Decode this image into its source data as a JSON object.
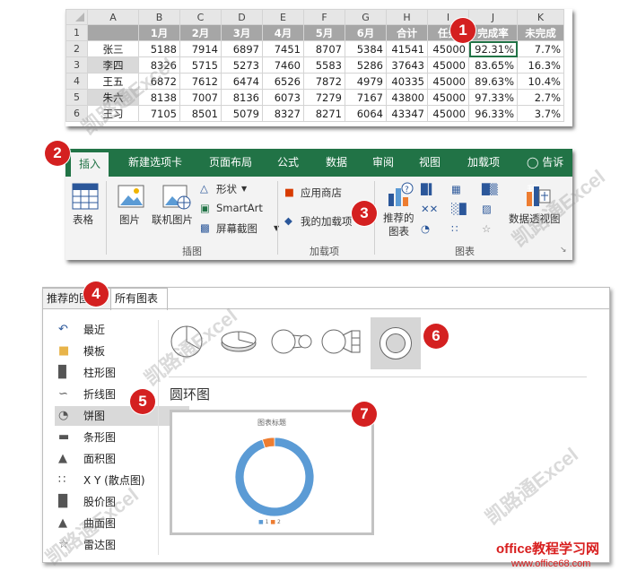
{
  "sheet": {
    "col_headers": [
      "A",
      "B",
      "C",
      "D",
      "E",
      "F",
      "G",
      "H",
      "I",
      "J",
      "K"
    ],
    "row_numbers": [
      "1",
      "2",
      "3",
      "4",
      "5",
      "6"
    ],
    "header_row": [
      "",
      "1月",
      "2月",
      "3月",
      "4月",
      "5月",
      "6月",
      "合计",
      "任务",
      "完成率",
      "未完成"
    ],
    "rows": [
      [
        "张三",
        "5188",
        "7914",
        "6897",
        "7451",
        "8707",
        "5384",
        "41541",
        "45000",
        "92.31%",
        "7.7%"
      ],
      [
        "李四",
        "8326",
        "5715",
        "5273",
        "7460",
        "5583",
        "5286",
        "37643",
        "45000",
        "83.65%",
        "16.3%"
      ],
      [
        "王五",
        "6872",
        "7612",
        "6474",
        "6526",
        "7872",
        "4979",
        "40335",
        "45000",
        "89.63%",
        "10.4%"
      ],
      [
        "朱六",
        "8138",
        "7007",
        "8136",
        "6073",
        "7279",
        "7167",
        "43800",
        "45000",
        "97.33%",
        "2.7%"
      ],
      [
        "王习",
        "7105",
        "8501",
        "5079",
        "8327",
        "8271",
        "6064",
        "43347",
        "45000",
        "96.33%",
        "3.7%"
      ]
    ]
  },
  "ribbon": {
    "tabs": [
      "插入",
      "新建选项卡",
      "页面布局",
      "公式",
      "数据",
      "审阅",
      "视图",
      "加载项",
      "告诉我"
    ],
    "table_label": "表格",
    "picture_label": "图片",
    "online_picture_label": "联机图片",
    "shapes_label": "形状",
    "smartart_label": "SmartArt",
    "screenshot_label": "屏幕截图",
    "group_illustrations": "插图",
    "store_label": "应用商店",
    "my_addins_label": "我的加载项",
    "group_addins": "加载项",
    "recommended_charts_line1": "推荐的",
    "recommended_charts_line2": "图表",
    "pivotchart_label": "数据透视图",
    "group_charts": "图表"
  },
  "dialog": {
    "tabs": [
      "推荐的图表",
      "所有图表"
    ],
    "nav": [
      "最近",
      "模板",
      "柱形图",
      "折线图",
      "饼图",
      "条形图",
      "面积图",
      "X Y (散点图)",
      "股价图",
      "曲面图",
      "雷达图"
    ],
    "selected_nav": "饼图",
    "chart_type_title": "圆环图",
    "preview_title": "图表标题",
    "preview_legend": [
      "1",
      "2"
    ],
    "donut_values": [
      0.95,
      0.05
    ],
    "colors": {
      "series1": "#5b9bd5",
      "series2": "#ed7d31"
    }
  },
  "badges": [
    "1",
    "2",
    "3",
    "4",
    "5",
    "6",
    "7"
  ],
  "watermark": "凯路通Excel",
  "footer": {
    "site_name": "office教程学习网",
    "url": "www.office68.com"
  }
}
